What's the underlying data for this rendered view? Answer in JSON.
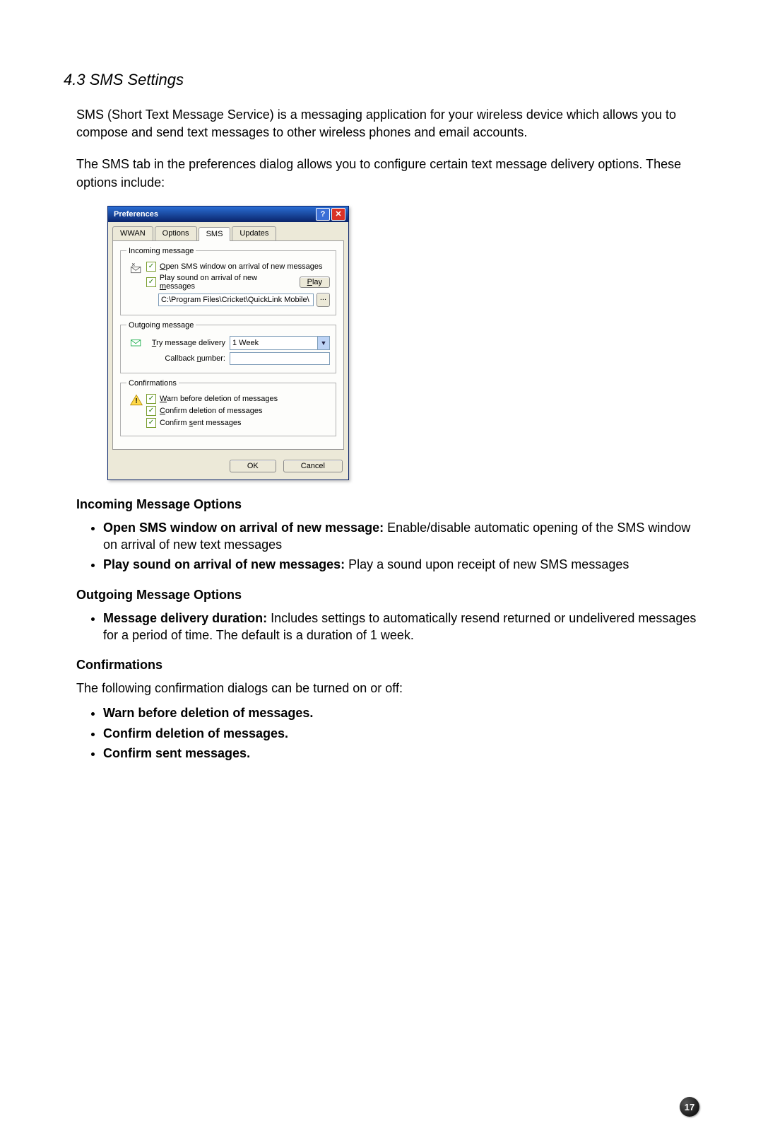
{
  "section_title": "4.3 SMS Settings",
  "para1": "SMS (Short Text Message Service) is a messaging application for your wireless device which allows you to compose and send text messages to other wireless phones and email accounts.",
  "para2": "The SMS tab in the preferences dialog allows you to configure certain text message delivery options. These options include:",
  "dialog": {
    "title": "Preferences",
    "tabs": [
      "WWAN",
      "Options",
      "SMS",
      "Updates"
    ],
    "active_tab": "SMS",
    "incoming": {
      "legend": "Incoming message",
      "open_label_pre": "O",
      "open_label": "pen SMS window on arrival of new messages",
      "play_pre": "Play sound on arrival of new ",
      "play_key": "m",
      "play_post": "essages",
      "play_btn_key": "P",
      "play_btn_rest": "lay",
      "path_value": "C:\\Program Files\\Cricket\\QuickLink Mobile\\",
      "browse_btn": "..."
    },
    "outgoing": {
      "legend": "Outgoing message",
      "try_key": "T",
      "try_rest": "ry message delivery",
      "duration_value": "1 Week",
      "callback_pre": "Callback ",
      "callback_key": "n",
      "callback_post": "umber:",
      "callback_value": ""
    },
    "confirm": {
      "legend": "Confirmations",
      "warn_key": "W",
      "warn_rest": "arn before deletion of messages",
      "confirm_del_key": "C",
      "confirm_del_rest": "onfirm deletion of messages",
      "confirm_sent_pre": "Confirm ",
      "confirm_sent_key": "s",
      "confirm_sent_post": "ent messages"
    },
    "ok": "OK",
    "cancel": "Cancel"
  },
  "incoming_heading": "Incoming Message Options",
  "incoming_bullets": [
    {
      "bold": "Open SMS window on arrival of new message:",
      "rest": " Enable/disable automatic opening of the SMS window on arrival of new text messages"
    },
    {
      "bold": "Play sound on arrival of new messages:",
      "rest": " Play a sound upon receipt of new SMS messages"
    }
  ],
  "outgoing_heading": "Outgoing Message Options",
  "outgoing_bullets": [
    {
      "bold": "Message delivery duration:",
      "rest": " Includes settings to automatically resend returned or undelivered messages for a period of time. The default is a duration of 1 week."
    }
  ],
  "confirm_heading": "Confirmations",
  "confirm_intro": "The following confirmation dialogs can be turned on or off:",
  "confirm_bullets": [
    "Warn before deletion of messages.",
    "Confirm deletion of messages.",
    "Confirm sent messages."
  ],
  "page_number": "17"
}
